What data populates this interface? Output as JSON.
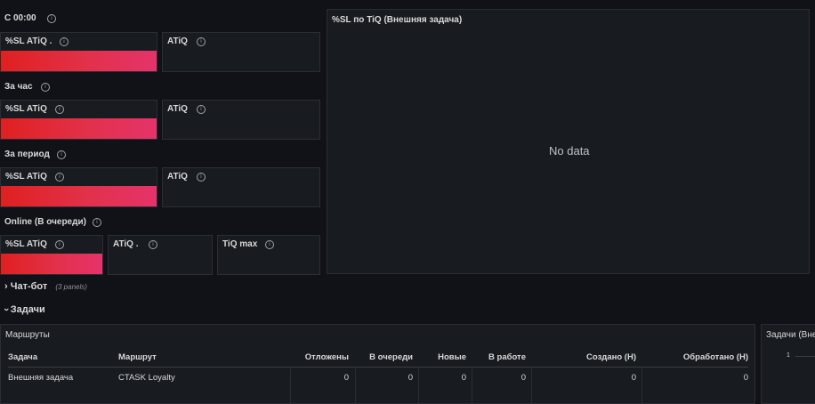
{
  "rows": {
    "today": "С 00:00",
    "hour": "За час",
    "period": "За период",
    "online": "Online (В очереди)"
  },
  "panels": {
    "today_sl": "%SL ATiQ .",
    "today_atiq": "ATiQ",
    "hour_sl": "%SL ATiQ",
    "hour_atiq": "ATiQ",
    "period_sl": "%SL ATiQ",
    "period_atiq": "ATiQ",
    "online_sl": "%SL ATiQ",
    "online_atiq": "ATiQ .",
    "online_tiq": "TiQ max"
  },
  "big_panel": {
    "title": "%SL по TiQ (Внешняя задача)",
    "no_data": "No data"
  },
  "info_glyph": "i",
  "sections": {
    "chatbot": {
      "chevron": "›",
      "title": "Чат-бот",
      "meta": "(3 panels)"
    },
    "tasks": {
      "chevron": "›",
      "title": "Задачи"
    }
  },
  "routes_panel": {
    "title": "Маршруты",
    "columns": [
      "Задача",
      "Маршрут",
      "Отложены",
      "В очереди",
      "Новые",
      "В работе",
      "Создано (Н)",
      "Обработано (Н)"
    ],
    "rows": [
      [
        "Внешняя задача",
        "CTASK Loyalty",
        "0",
        "0",
        "0",
        "0",
        "0",
        "0"
      ]
    ]
  },
  "right_panel": {
    "title": "Задачи (Вне",
    "tick": "1"
  }
}
